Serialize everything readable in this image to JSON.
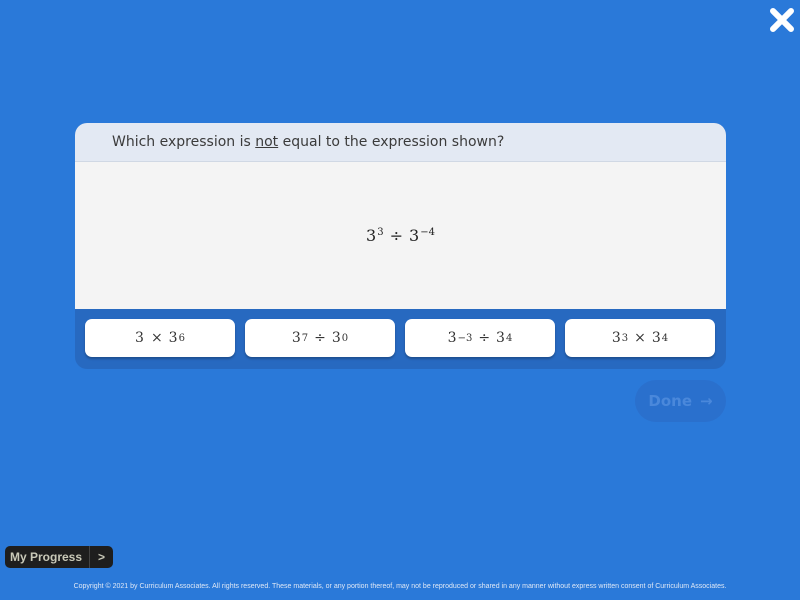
{
  "close_icon": "close-x",
  "question": {
    "prefix": "Which expression is ",
    "emphasis": "not",
    "suffix": " equal to the expression shown?"
  },
  "stem": {
    "base1": "3",
    "exp1": "3",
    "operator": "÷",
    "base2": "3",
    "exp2": "−4"
  },
  "choices": [
    {
      "base1": "3",
      "exp1": "",
      "operator": "×",
      "base2": "3",
      "exp2": "6"
    },
    {
      "base1": "3",
      "exp1": "7",
      "operator": "÷",
      "base2": "3",
      "exp2": "0"
    },
    {
      "base1": "3",
      "exp1": "−3",
      "operator": "÷",
      "base2": "3",
      "exp2": "4"
    },
    {
      "base1": "3",
      "exp1": "3",
      "operator": "×",
      "base2": "3",
      "exp2": "4"
    }
  ],
  "done": {
    "label": "Done",
    "arrow": "→"
  },
  "my_progress": {
    "label": "My Progress",
    "arrow": ">"
  },
  "footer": "Copyright © 2021 by Curriculum Associates. All rights reserved. These materials, or any portion thereof, may not be reproduced or shared in any manner without express written consent of Curriculum Associates."
}
